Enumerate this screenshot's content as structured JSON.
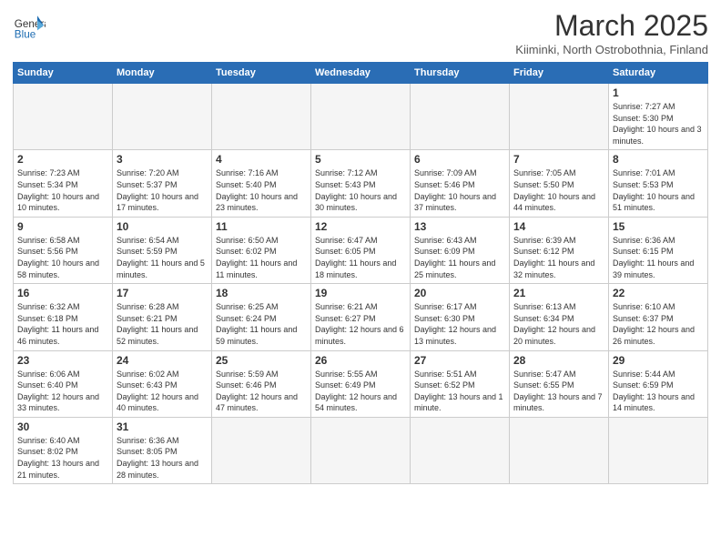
{
  "header": {
    "logo_general": "General",
    "logo_blue": "Blue",
    "month_title": "March 2025",
    "subtitle": "Kiiminki, North Ostrobothnia, Finland"
  },
  "weekdays": [
    "Sunday",
    "Monday",
    "Tuesday",
    "Wednesday",
    "Thursday",
    "Friday",
    "Saturday"
  ],
  "weeks": [
    [
      {
        "day": "",
        "info": ""
      },
      {
        "day": "",
        "info": ""
      },
      {
        "day": "",
        "info": ""
      },
      {
        "day": "",
        "info": ""
      },
      {
        "day": "",
        "info": ""
      },
      {
        "day": "",
        "info": ""
      },
      {
        "day": "1",
        "info": "Sunrise: 7:27 AM\nSunset: 5:30 PM\nDaylight: 10 hours and 3 minutes."
      }
    ],
    [
      {
        "day": "2",
        "info": "Sunrise: 7:23 AM\nSunset: 5:34 PM\nDaylight: 10 hours and 10 minutes."
      },
      {
        "day": "3",
        "info": "Sunrise: 7:20 AM\nSunset: 5:37 PM\nDaylight: 10 hours and 17 minutes."
      },
      {
        "day": "4",
        "info": "Sunrise: 7:16 AM\nSunset: 5:40 PM\nDaylight: 10 hours and 23 minutes."
      },
      {
        "day": "5",
        "info": "Sunrise: 7:12 AM\nSunset: 5:43 PM\nDaylight: 10 hours and 30 minutes."
      },
      {
        "day": "6",
        "info": "Sunrise: 7:09 AM\nSunset: 5:46 PM\nDaylight: 10 hours and 37 minutes."
      },
      {
        "day": "7",
        "info": "Sunrise: 7:05 AM\nSunset: 5:50 PM\nDaylight: 10 hours and 44 minutes."
      },
      {
        "day": "8",
        "info": "Sunrise: 7:01 AM\nSunset: 5:53 PM\nDaylight: 10 hours and 51 minutes."
      }
    ],
    [
      {
        "day": "9",
        "info": "Sunrise: 6:58 AM\nSunset: 5:56 PM\nDaylight: 10 hours and 58 minutes."
      },
      {
        "day": "10",
        "info": "Sunrise: 6:54 AM\nSunset: 5:59 PM\nDaylight: 11 hours and 5 minutes."
      },
      {
        "day": "11",
        "info": "Sunrise: 6:50 AM\nSunset: 6:02 PM\nDaylight: 11 hours and 11 minutes."
      },
      {
        "day": "12",
        "info": "Sunrise: 6:47 AM\nSunset: 6:05 PM\nDaylight: 11 hours and 18 minutes."
      },
      {
        "day": "13",
        "info": "Sunrise: 6:43 AM\nSunset: 6:09 PM\nDaylight: 11 hours and 25 minutes."
      },
      {
        "day": "14",
        "info": "Sunrise: 6:39 AM\nSunset: 6:12 PM\nDaylight: 11 hours and 32 minutes."
      },
      {
        "day": "15",
        "info": "Sunrise: 6:36 AM\nSunset: 6:15 PM\nDaylight: 11 hours and 39 minutes."
      }
    ],
    [
      {
        "day": "16",
        "info": "Sunrise: 6:32 AM\nSunset: 6:18 PM\nDaylight: 11 hours and 46 minutes."
      },
      {
        "day": "17",
        "info": "Sunrise: 6:28 AM\nSunset: 6:21 PM\nDaylight: 11 hours and 52 minutes."
      },
      {
        "day": "18",
        "info": "Sunrise: 6:25 AM\nSunset: 6:24 PM\nDaylight: 11 hours and 59 minutes."
      },
      {
        "day": "19",
        "info": "Sunrise: 6:21 AM\nSunset: 6:27 PM\nDaylight: 12 hours and 6 minutes."
      },
      {
        "day": "20",
        "info": "Sunrise: 6:17 AM\nSunset: 6:30 PM\nDaylight: 12 hours and 13 minutes."
      },
      {
        "day": "21",
        "info": "Sunrise: 6:13 AM\nSunset: 6:34 PM\nDaylight: 12 hours and 20 minutes."
      },
      {
        "day": "22",
        "info": "Sunrise: 6:10 AM\nSunset: 6:37 PM\nDaylight: 12 hours and 26 minutes."
      }
    ],
    [
      {
        "day": "23",
        "info": "Sunrise: 6:06 AM\nSunset: 6:40 PM\nDaylight: 12 hours and 33 minutes."
      },
      {
        "day": "24",
        "info": "Sunrise: 6:02 AM\nSunset: 6:43 PM\nDaylight: 12 hours and 40 minutes."
      },
      {
        "day": "25",
        "info": "Sunrise: 5:59 AM\nSunset: 6:46 PM\nDaylight: 12 hours and 47 minutes."
      },
      {
        "day": "26",
        "info": "Sunrise: 5:55 AM\nSunset: 6:49 PM\nDaylight: 12 hours and 54 minutes."
      },
      {
        "day": "27",
        "info": "Sunrise: 5:51 AM\nSunset: 6:52 PM\nDaylight: 13 hours and 1 minute."
      },
      {
        "day": "28",
        "info": "Sunrise: 5:47 AM\nSunset: 6:55 PM\nDaylight: 13 hours and 7 minutes."
      },
      {
        "day": "29",
        "info": "Sunrise: 5:44 AM\nSunset: 6:59 PM\nDaylight: 13 hours and 14 minutes."
      }
    ],
    [
      {
        "day": "30",
        "info": "Sunrise: 6:40 AM\nSunset: 8:02 PM\nDaylight: 13 hours and 21 minutes."
      },
      {
        "day": "31",
        "info": "Sunrise: 6:36 AM\nSunset: 8:05 PM\nDaylight: 13 hours and 28 minutes."
      },
      {
        "day": "",
        "info": ""
      },
      {
        "day": "",
        "info": ""
      },
      {
        "day": "",
        "info": ""
      },
      {
        "day": "",
        "info": ""
      },
      {
        "day": "",
        "info": ""
      }
    ]
  ]
}
